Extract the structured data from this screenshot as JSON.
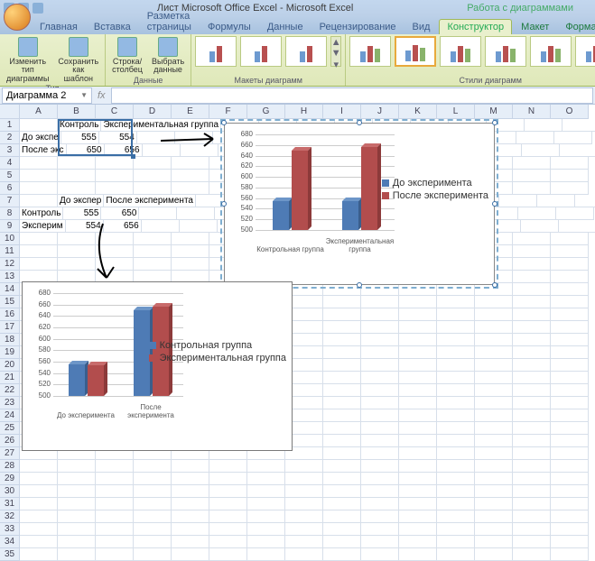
{
  "window": {
    "title": "Лист Microsoft Office Excel - Microsoft Excel",
    "context_title": "Работа с диаграммами"
  },
  "tabs": {
    "main": [
      "Главная",
      "Вставка",
      "Разметка страницы",
      "Формулы",
      "Данные",
      "Рецензирование",
      "Вид"
    ],
    "context": [
      "Конструктор",
      "Макет",
      "Формат"
    ],
    "active": "Конструктор"
  },
  "ribbon": {
    "groups": {
      "type": {
        "label": "Тип",
        "btn_change": "Изменить тип\nдиаграммы",
        "btn_save": "Сохранить\nкак шаблон"
      },
      "data": {
        "label": "Данные",
        "btn_switch": "Строка/столбец",
        "btn_select": "Выбрать\nданные"
      },
      "layouts": {
        "label": "Макеты диаграмм"
      },
      "styles": {
        "label": "Стили диаграмм"
      }
    }
  },
  "namebox": "Диаграмма 2",
  "formula": "",
  "columns": [
    "A",
    "B",
    "C",
    "D",
    "E",
    "F",
    "G",
    "H",
    "I",
    "J",
    "K",
    "L",
    "M",
    "N",
    "O"
  ],
  "row_count": 35,
  "cells": {
    "B1": "Контроль",
    "C1": "Экспериментальная группа",
    "A2": "До экспе",
    "B2": "555",
    "C2": "554",
    "A3": "После экс",
    "B3": "650",
    "C3": "656",
    "B7": "До экспер",
    "C7": "После эксперимента",
    "A8": "Контроль",
    "B8": "555",
    "C8": "650",
    "A9": "Эксперим",
    "B9": "554",
    "C9": "656"
  },
  "selection": {
    "from": "B1",
    "to": "C3"
  },
  "chart_data": [
    {
      "id": "chart1_top_right",
      "type": "bar",
      "categories": [
        "Контрольная группа",
        "Экспериментальная группа"
      ],
      "series": [
        {
          "name": "До эксперимента",
          "values": [
            555,
            554
          ],
          "color": "#4e7bb5"
        },
        {
          "name": "После эксперимента",
          "values": [
            650,
            656
          ],
          "color": "#b24d4d"
        }
      ],
      "ylim": [
        500,
        680
      ],
      "yticks": [
        500,
        520,
        540,
        560,
        580,
        600,
        620,
        640,
        660,
        680
      ],
      "legend_position": "right"
    },
    {
      "id": "chart2_bottom_left",
      "type": "bar",
      "categories": [
        "До эксперимента",
        "После эксперимента"
      ],
      "series": [
        {
          "name": "Контрольная группа",
          "values": [
            555,
            650
          ],
          "color": "#4e7bb5"
        },
        {
          "name": "Экспериментальная группа",
          "values": [
            554,
            656
          ],
          "color": "#b24d4d"
        }
      ],
      "ylim": [
        500,
        680
      ],
      "yticks": [
        500,
        520,
        540,
        560,
        580,
        600,
        620,
        640,
        660,
        680
      ],
      "legend_position": "right"
    }
  ]
}
